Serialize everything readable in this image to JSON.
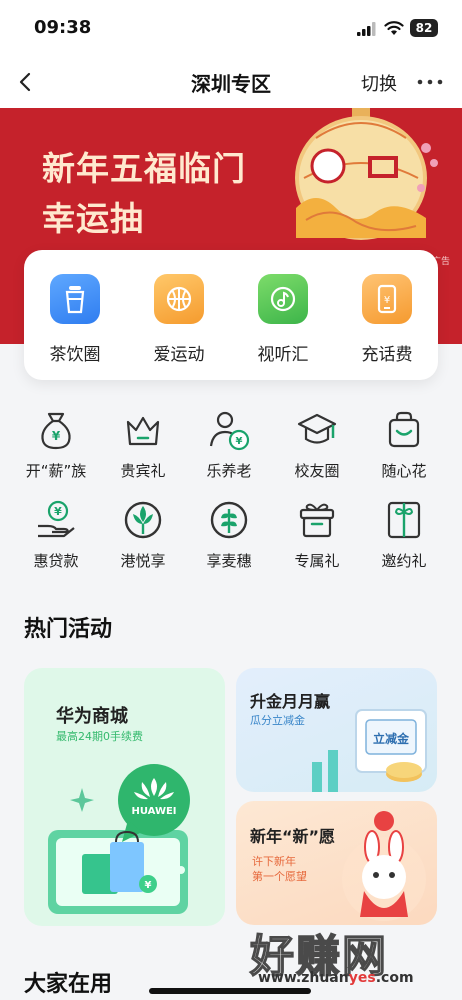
{
  "status_bar": {
    "time": "09:38",
    "battery": "82"
  },
  "nav": {
    "title": "深圳专区",
    "switch_label": "切换"
  },
  "banner": {
    "line1": "新年五福临门",
    "line2": "幸运抽",
    "ad_tag": "广告"
  },
  "quick_actions": [
    {
      "label": "茶饮圈",
      "icon": "cup-icon",
      "color": "#3b82f6"
    },
    {
      "label": "爱运动",
      "icon": "basketball-icon",
      "color": "#f5a532"
    },
    {
      "label": "视听汇",
      "icon": "music-icon",
      "color": "#4cc45a"
    },
    {
      "label": "充话费",
      "icon": "phone-recharge-icon",
      "color": "#f6a534"
    }
  ],
  "grid": [
    {
      "label": "开“薪”族",
      "icon": "money-bag-icon"
    },
    {
      "label": "贵宾礼",
      "icon": "crown-icon"
    },
    {
      "label": "乐养老",
      "icon": "person-yuan-icon"
    },
    {
      "label": "校友圈",
      "icon": "graduation-cap-icon"
    },
    {
      "label": "随心花",
      "icon": "shopping-bag-icon"
    },
    {
      "label": "惠贷款",
      "icon": "hand-coin-icon"
    },
    {
      "label": "港悦享",
      "icon": "hk-emblem-icon"
    },
    {
      "label": "享麦穗",
      "icon": "wheat-icon"
    },
    {
      "label": "专属礼",
      "icon": "gift-icon"
    },
    {
      "label": "邀约礼",
      "icon": "invitation-icon"
    }
  ],
  "hot_section": {
    "title": "热门活动"
  },
  "cards": {
    "huawei": {
      "title": "华为商城",
      "subtitle": "最高24期0手续费",
      "logo_text": "HUAWEI"
    },
    "gold": {
      "title": "升金月月赢",
      "subtitle": "瓜分立减金",
      "coupon_text": "立减金"
    },
    "wish": {
      "title": "新年“新”愿",
      "line1": "许下新年",
      "line2": "第一个愿望"
    }
  },
  "bottom_section": {
    "title": "大家在用"
  },
  "watermark": {
    "main": "好赚网",
    "url_prefix": "www.zhuan",
    "url_highlight": "yes",
    "url_suffix": ".com"
  },
  "colors": {
    "brand_green": "#1aa36b",
    "banner_red": "#c5222b"
  }
}
